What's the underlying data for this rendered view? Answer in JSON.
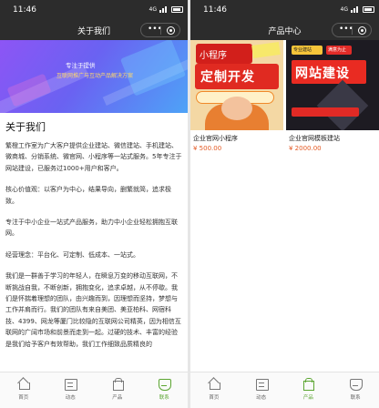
{
  "status": {
    "time": "11:46",
    "network": "4G"
  },
  "left": {
    "title": "关于我们",
    "banner": {
      "line1": "专注于提供",
      "line2": "互联网推广与互动产品解决方案"
    },
    "about_heading": "关于我们",
    "paragraphs": [
      "繁橙工作室为广大客户提供企业建站、微信建站、手机建站、微商城、分销系统、微官网、小程序等一站式服务。5年专注于网站建设，已服务过1000+用户和客户。",
      "核心价值观：以客户为中心，结果导向，删繁就简，追求极致。",
      "专注于中小企业一站式产品服务，助力中小企业轻松拥抱互联网。",
      "经营理念：平台化、可定制、低成本、一站式。",
      "我们是一群善于学习的年轻人，在瞬息万变的移动互联网，不断挑战自我，不断创新，拥抱变化，追求卓越，从不停歇。我们是怀揣着理想的团队，由兴趣而到，因理想而坚持，梦想与工作并肩而行。我们的团队有来自美团、美亚柏科、网宿科技、4399、网龙等厦门比较隐的互联网公司精英，因为相信互联网的广阔市场和前景而走到一起。过硬的技术、丰富的经验是我们给予客户有效帮助，我们工作细致品质精良的"
    ]
  },
  "right": {
    "title": "产品中心",
    "products": [
      {
        "name": "企业官网小程序",
        "price": "¥ 500.00",
        "poster_line1": "小程序",
        "poster_line2": "定制开发"
      },
      {
        "name": "企业官网模板建站",
        "price": "¥ 2000.00",
        "poster_tag1": "专业建站",
        "poster_tag2": "满意为止",
        "poster_line": "网站建设"
      }
    ]
  },
  "tabbar": {
    "items": [
      {
        "label": "首页",
        "icon": "home-icon"
      },
      {
        "label": "动态",
        "icon": "news-icon"
      },
      {
        "label": "产品",
        "icon": "product-icon"
      },
      {
        "label": "联系",
        "icon": "contact-icon"
      }
    ],
    "left_active": 3,
    "right_active": 2,
    "active_color": "#5ba531"
  },
  "colors": {
    "header": "#2c2c2c",
    "price": "#e45a24",
    "accent": "#5ba531"
  }
}
